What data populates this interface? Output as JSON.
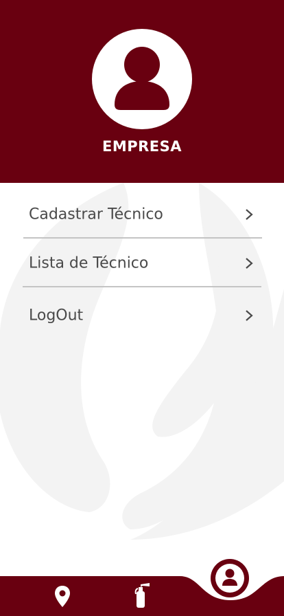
{
  "header": {
    "company_name": "EMPRESA"
  },
  "menu": {
    "items": [
      {
        "label": "Cadastrar Técnico"
      },
      {
        "label": "Lista de Técnico"
      },
      {
        "label": "LogOut"
      }
    ]
  },
  "tabbar": {
    "tabs": [
      {
        "icon": "location-pin-icon"
      },
      {
        "icon": "fire-extinguisher-icon"
      },
      {
        "icon": "user-profile-icon",
        "active": true
      }
    ]
  },
  "colors": {
    "primary": "#690010",
    "text": "#4a4a4a",
    "divider": "#c4c4c4",
    "watermark": "#f4f4f4"
  }
}
